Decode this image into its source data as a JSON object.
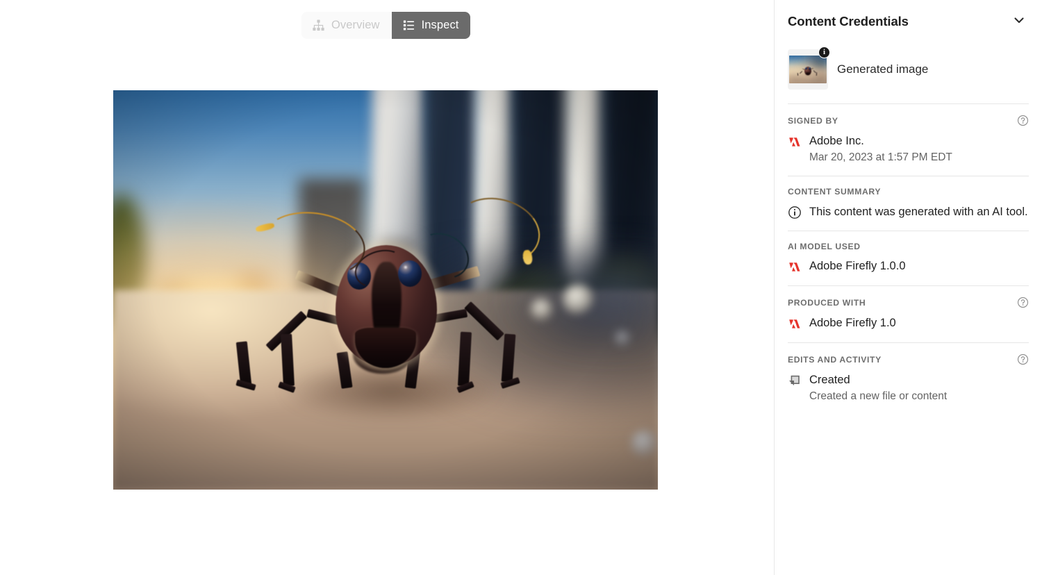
{
  "viewer": {
    "tabs": [
      {
        "id": "overview",
        "label": "Overview",
        "icon": "hierarchy-icon",
        "active": false
      },
      {
        "id": "inspect",
        "label": "Inspect",
        "icon": "list-detail-icon",
        "active": true
      }
    ],
    "image_alt": "Generated image of a macro ant in front of a blurred city skyline at sunset"
  },
  "sidebar": {
    "title": "Content Credentials",
    "collapse_icon": "chevron-down-icon",
    "asset": {
      "label": "Generated image",
      "badge_icon": "info-badge-icon",
      "thumbnail_alt": "Ant in city thumbnail"
    },
    "sections": [
      {
        "id": "signed-by",
        "title": "SIGNED BY",
        "help_icon": "help-circle-icon",
        "has_help": true,
        "icon": "adobe-logo-icon",
        "primary": "Adobe Inc.",
        "secondary": "Mar 20, 2023 at 1:57 PM EDT"
      },
      {
        "id": "content-summary",
        "title": "CONTENT SUMMARY",
        "has_help": false,
        "icon": "info-circle-icon",
        "primary": "This content was generated with an AI tool.",
        "secondary": ""
      },
      {
        "id": "ai-model-used",
        "title": "AI MODEL USED",
        "has_help": false,
        "icon": "adobe-logo-icon",
        "primary": "Adobe Firefly 1.0.0",
        "secondary": ""
      },
      {
        "id": "produced-with",
        "title": "PRODUCED WITH",
        "help_icon": "help-circle-icon",
        "has_help": true,
        "icon": "adobe-logo-icon",
        "primary": "Adobe Firefly 1.0",
        "secondary": ""
      },
      {
        "id": "edits-and-activity",
        "title": "EDITS AND ACTIVITY",
        "help_icon": "help-circle-icon",
        "has_help": true,
        "icon": "created-pages-icon",
        "primary": "Created",
        "secondary": "Created a new file or content"
      }
    ]
  },
  "colors": {
    "adobe_red": "#E5342C",
    "active_tab_bg": "#6B6B6B",
    "inactive_tab_text": "#C9C9C9",
    "section_label": "#6E6E6E",
    "body_text": "#1F1F1F",
    "secondary_text": "#636363",
    "divider": "#E6E6E6"
  }
}
